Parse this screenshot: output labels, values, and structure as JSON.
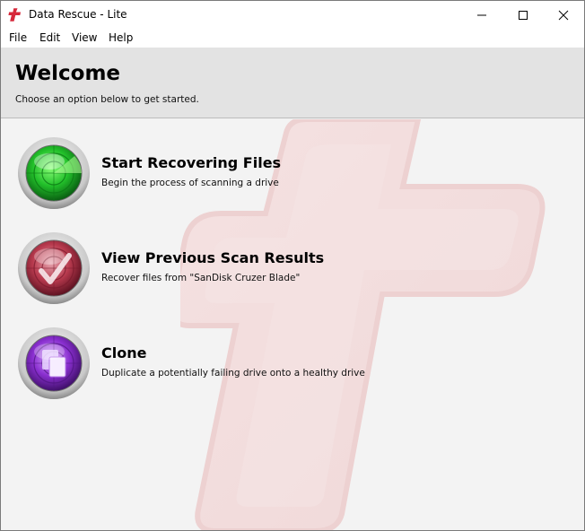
{
  "window": {
    "title": "Data Rescue - Lite",
    "controls": {
      "minimize": "minimize-icon",
      "maximize": "maximize-icon",
      "close": "close-icon"
    }
  },
  "menu": {
    "items": [
      "File",
      "Edit",
      "View",
      "Help"
    ]
  },
  "header": {
    "title": "Welcome",
    "subtitle": "Choose an option below to get started."
  },
  "options": [
    {
      "title": "Start Recovering Files",
      "description": "Begin the process of scanning a drive",
      "icon": "radar-icon",
      "color": "#22c02a"
    },
    {
      "title": "View Previous Scan Results",
      "description": "Recover files from \"SanDisk Cruzer Blade\"",
      "icon": "checkmark-radar-icon",
      "color": "#b83a4e"
    },
    {
      "title": "Clone",
      "description": "Duplicate a potentially failing drive onto a healthy drive",
      "icon": "clone-documents-icon",
      "color": "#8a2fd0"
    }
  ],
  "colors": {
    "brand": "#d6283a",
    "header_bg": "#e3e3e3",
    "content_bg": "#f3f3f3"
  }
}
